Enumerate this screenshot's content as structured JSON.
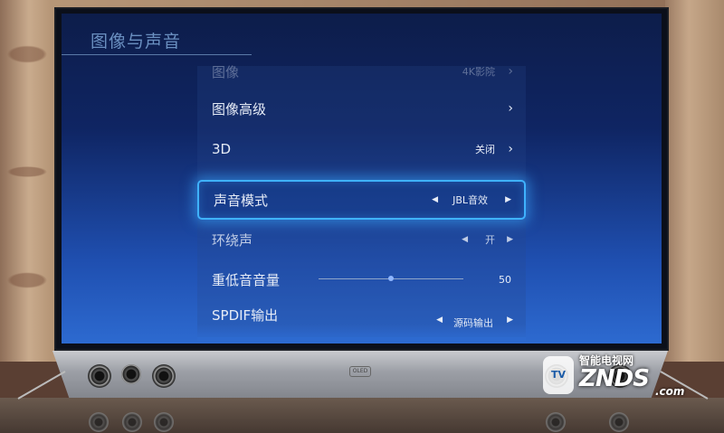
{
  "header": {
    "title": "图像与声音"
  },
  "menu": {
    "item_picture": {
      "label": "图像",
      "value": "4K影院"
    },
    "item_advanced": {
      "label": "图像高级"
    },
    "item_3d": {
      "label": "3D",
      "value": "关闭"
    },
    "item_sound_mode": {
      "label": "声音模式",
      "value": "JBL音效"
    },
    "item_surround": {
      "label": "环绕声",
      "value": "开"
    },
    "item_bass": {
      "label": "重低音音量",
      "value": "50",
      "level": 0.5
    },
    "item_spdif": {
      "label": "SPDIF输出",
      "value": "源码输出"
    }
  },
  "icons": {
    "chevron_right": "›",
    "arrow_left": "◀",
    "arrow_right": "▶"
  },
  "device": {
    "badge_text": "OLED"
  },
  "watermark": {
    "top": "智能电视网",
    "main": "ZNDS",
    "sub": ".com",
    "badge": "TV"
  },
  "colors": {
    "accent": "#3fb2ff",
    "screen_top": "#0d1d4a",
    "screen_bottom": "#2d6ad0"
  }
}
